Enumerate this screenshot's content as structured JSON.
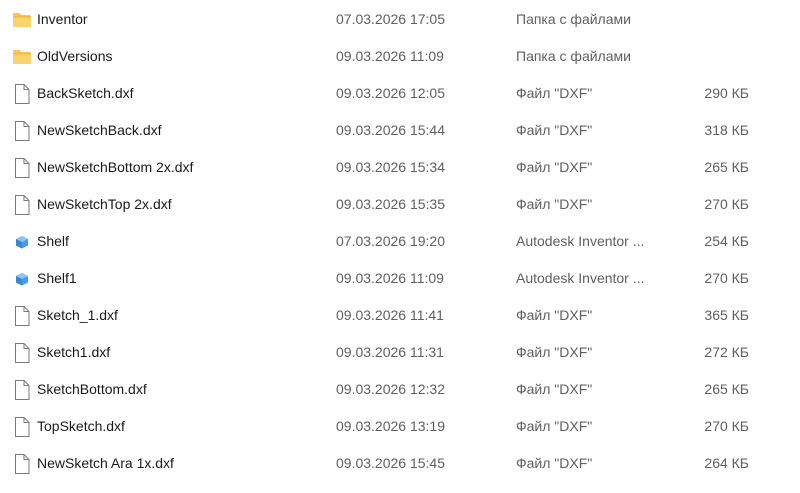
{
  "files": [
    {
      "name": "Inventor",
      "date": "07.03.2026 17:05",
      "type": "Папка с файлами",
      "size": "",
      "icon": "folder-icon"
    },
    {
      "name": "OldVersions",
      "date": "09.03.2026 11:09",
      "type": "Папка с файлами",
      "size": "",
      "icon": "folder-icon"
    },
    {
      "name": "BackSketch.dxf",
      "date": "09.03.2026 12:05",
      "type": "Файл \"DXF\"",
      "size": "290 КБ",
      "icon": "document-icon"
    },
    {
      "name": "NewSketchBack.dxf",
      "date": "09.03.2026 15:44",
      "type": "Файл \"DXF\"",
      "size": "318 КБ",
      "icon": "document-icon"
    },
    {
      "name": "NewSketchBottom 2x.dxf",
      "date": "09.03.2026 15:34",
      "type": "Файл \"DXF\"",
      "size": "265 КБ",
      "icon": "document-icon"
    },
    {
      "name": "NewSketchTop 2x.dxf",
      "date": "09.03.2026 15:35",
      "type": "Файл \"DXF\"",
      "size": "270 КБ",
      "icon": "document-icon"
    },
    {
      "name": "Shelf",
      "date": "07.03.2026 19:20",
      "type": "Autodesk Inventor ...",
      "size": "254 КБ",
      "icon": "inventor-part-icon"
    },
    {
      "name": "Shelf1",
      "date": "09.03.2026 11:09",
      "type": "Autodesk Inventor ...",
      "size": "270 КБ",
      "icon": "inventor-part-icon"
    },
    {
      "name": "Sketch_1.dxf",
      "date": "09.03.2026 11:41",
      "type": "Файл \"DXF\"",
      "size": "365 КБ",
      "icon": "document-icon"
    },
    {
      "name": "Sketch1.dxf",
      "date": "09.03.2026 11:31",
      "type": "Файл \"DXF\"",
      "size": "272 КБ",
      "icon": "document-icon"
    },
    {
      "name": "SketchBottom.dxf",
      "date": "09.03.2026 12:32",
      "type": "Файл \"DXF\"",
      "size": "265 КБ",
      "icon": "document-icon"
    },
    {
      "name": "TopSketch.dxf",
      "date": "09.03.2026 13:19",
      "type": "Файл \"DXF\"",
      "size": "270 КБ",
      "icon": "document-icon"
    },
    {
      "name": "NewSketch Ara 1x.dxf",
      "date": "09.03.2026 15:45",
      "type": "Файл \"DXF\"",
      "size": "264 КБ",
      "icon": "document-icon"
    }
  ],
  "colors": {
    "folder": "#f8c652",
    "folder_dark": "#e8a933",
    "document_border": "#7a7a7a",
    "inventor_part": "#4a9ae0"
  }
}
